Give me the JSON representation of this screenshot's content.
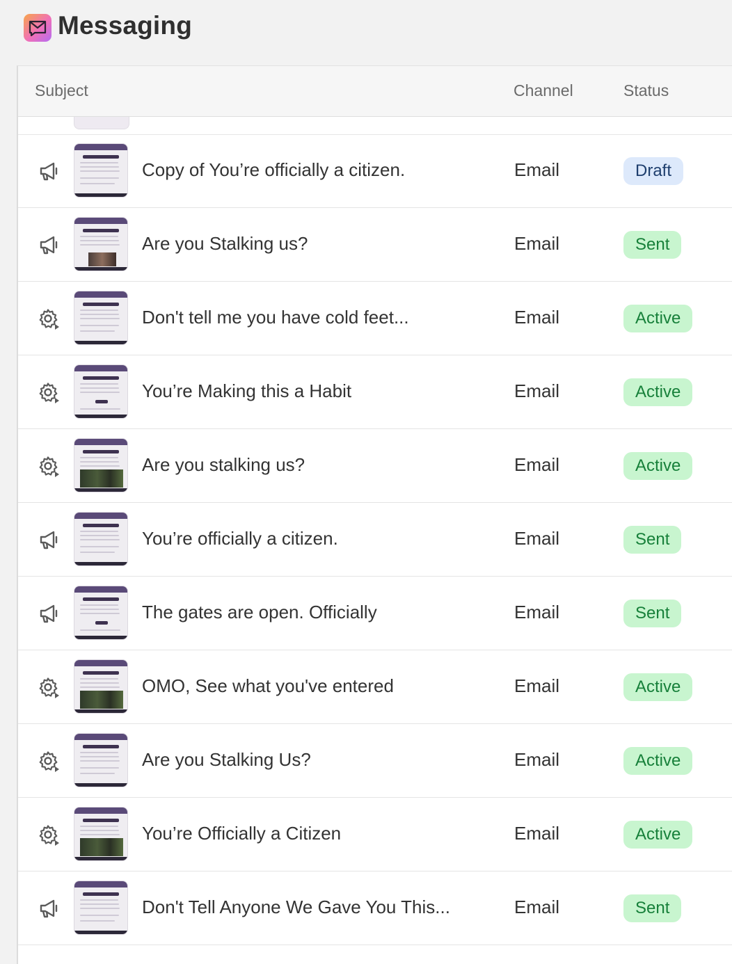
{
  "app": {
    "title": "Messaging",
    "icon": "messaging-app-icon"
  },
  "table": {
    "columns": {
      "subject": "Subject",
      "channel": "Channel",
      "status": "Status"
    },
    "rows": [
      {
        "type_icon": "megaphone-icon",
        "thumb_variant": "plain",
        "subject": "Copy of You’re officially a citizen.",
        "channel": "Email",
        "status": "Draft",
        "status_kind": "draft"
      },
      {
        "type_icon": "megaphone-icon",
        "thumb_variant": "small-photo",
        "subject": "Are you Stalking us?",
        "channel": "Email",
        "status": "Sent",
        "status_kind": "sent"
      },
      {
        "type_icon": "gear-icon",
        "thumb_variant": "plain",
        "subject": "Don't tell me you have cold feet...",
        "channel": "Email",
        "status": "Active",
        "status_kind": "active"
      },
      {
        "type_icon": "gear-icon",
        "thumb_variant": "button",
        "subject": "You’re Making this a Habit",
        "channel": "Email",
        "status": "Active",
        "status_kind": "active"
      },
      {
        "type_icon": "gear-icon",
        "thumb_variant": "photo",
        "subject": "Are you stalking us?",
        "channel": "Email",
        "status": "Active",
        "status_kind": "active"
      },
      {
        "type_icon": "megaphone-icon",
        "thumb_variant": "plain",
        "subject": "You’re officially a citizen.",
        "channel": "Email",
        "status": "Sent",
        "status_kind": "sent"
      },
      {
        "type_icon": "megaphone-icon",
        "thumb_variant": "button",
        "subject": "The gates are open. Officially",
        "channel": "Email",
        "status": "Sent",
        "status_kind": "sent"
      },
      {
        "type_icon": "gear-icon",
        "thumb_variant": "photo",
        "subject": "OMO, See what you've entered",
        "channel": "Email",
        "status": "Active",
        "status_kind": "active"
      },
      {
        "type_icon": "gear-icon",
        "thumb_variant": "plain",
        "subject": "Are you Stalking Us?",
        "channel": "Email",
        "status": "Active",
        "status_kind": "active"
      },
      {
        "type_icon": "gear-icon",
        "thumb_variant": "photo",
        "subject": "You’re Officially a Citizen",
        "channel": "Email",
        "status": "Active",
        "status_kind": "active"
      },
      {
        "type_icon": "megaphone-icon",
        "thumb_variant": "plain",
        "subject": "Don't Tell Anyone We Gave You This...",
        "channel": "Email",
        "status": "Sent",
        "status_kind": "sent"
      }
    ]
  },
  "colors": {
    "status_green_bg": "#c8f5cf",
    "status_green_text": "#17803a",
    "status_draft_bg": "#dde9fb",
    "status_draft_text": "#1f3f6e",
    "thumb_header": "#5a4a78"
  }
}
